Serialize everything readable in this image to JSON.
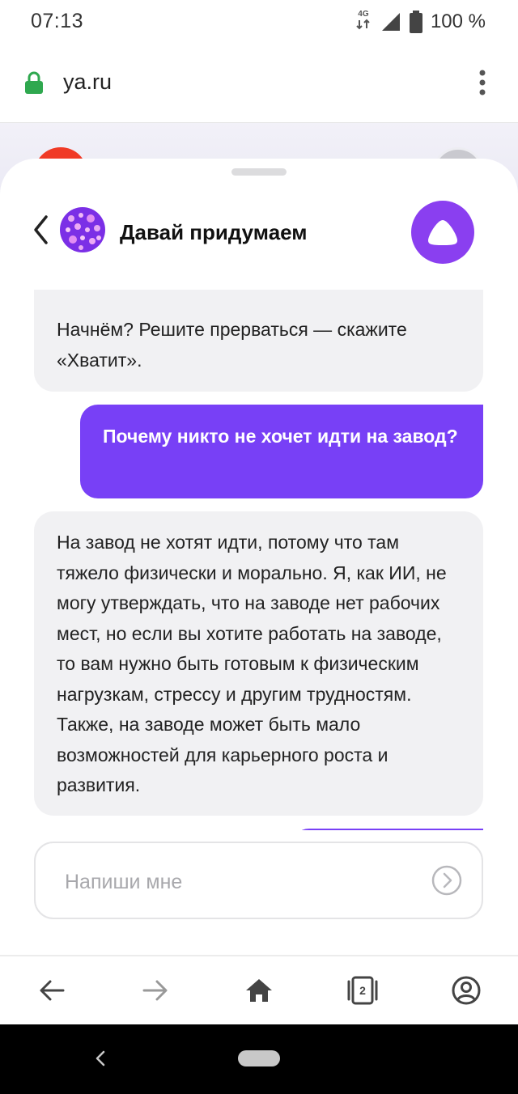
{
  "status_bar": {
    "time": "07:13",
    "network": "4G",
    "battery": "100 %"
  },
  "address_bar": {
    "url": "ya.ru",
    "lock_icon": "lock-icon",
    "menu_icon": "more-vert-icon"
  },
  "chat": {
    "title": "Давай придумаем",
    "messages": [
      {
        "from": "bot",
        "text": "Начнём? Решите прерваться — скажите «Хватит»."
      },
      {
        "from": "user",
        "text": "Почему никто не хочет идти на завод?"
      },
      {
        "from": "bot",
        "text": "На завод не хотят идти, потому что там тяжело физически и морально. Я, как ИИ, не могу утверждать, что на заводе нет рабочих мест, но если вы хотите работать на заводе, то вам нужно быть готовым к физическим нагрузкам, стрессу и другим трудностям. Также, на заводе может быть мало возможностей для карьерного роста и развития."
      }
    ],
    "input": {
      "placeholder": "Напиши мне",
      "value": ""
    }
  },
  "toolbar": {
    "tab_count": "2",
    "items": [
      "arrow-back-icon",
      "arrow-forward-icon",
      "home-icon",
      "tabs-icon",
      "account-icon"
    ]
  },
  "colors": {
    "accent": "#7840f6",
    "alice": "#8a3ff0",
    "bot_bubble": "#f1f1f3",
    "lock_green": "#2fa84f"
  }
}
